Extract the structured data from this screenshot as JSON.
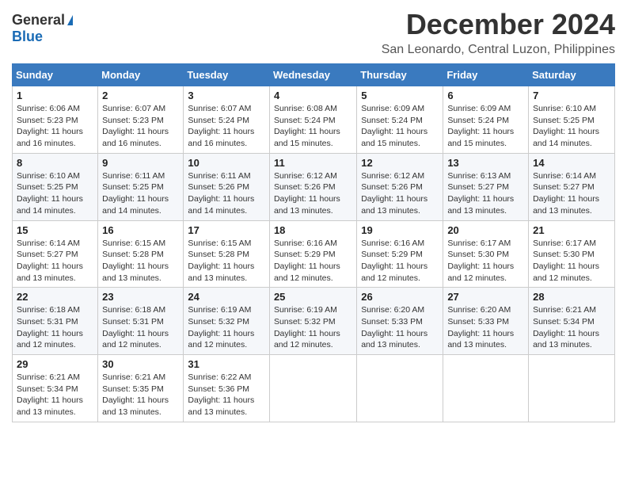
{
  "logo": {
    "line1": "General",
    "line2": "Blue"
  },
  "title": "December 2024",
  "subtitle": "San Leonardo, Central Luzon, Philippines",
  "days_header": [
    "Sunday",
    "Monday",
    "Tuesday",
    "Wednesday",
    "Thursday",
    "Friday",
    "Saturday"
  ],
  "weeks": [
    [
      {
        "day": "1",
        "info": "Sunrise: 6:06 AM\nSunset: 5:23 PM\nDaylight: 11 hours and 16 minutes."
      },
      {
        "day": "2",
        "info": "Sunrise: 6:07 AM\nSunset: 5:23 PM\nDaylight: 11 hours and 16 minutes."
      },
      {
        "day": "3",
        "info": "Sunrise: 6:07 AM\nSunset: 5:24 PM\nDaylight: 11 hours and 16 minutes."
      },
      {
        "day": "4",
        "info": "Sunrise: 6:08 AM\nSunset: 5:24 PM\nDaylight: 11 hours and 15 minutes."
      },
      {
        "day": "5",
        "info": "Sunrise: 6:09 AM\nSunset: 5:24 PM\nDaylight: 11 hours and 15 minutes."
      },
      {
        "day": "6",
        "info": "Sunrise: 6:09 AM\nSunset: 5:24 PM\nDaylight: 11 hours and 15 minutes."
      },
      {
        "day": "7",
        "info": "Sunrise: 6:10 AM\nSunset: 5:25 PM\nDaylight: 11 hours and 14 minutes."
      }
    ],
    [
      {
        "day": "8",
        "info": "Sunrise: 6:10 AM\nSunset: 5:25 PM\nDaylight: 11 hours and 14 minutes."
      },
      {
        "day": "9",
        "info": "Sunrise: 6:11 AM\nSunset: 5:25 PM\nDaylight: 11 hours and 14 minutes."
      },
      {
        "day": "10",
        "info": "Sunrise: 6:11 AM\nSunset: 5:26 PM\nDaylight: 11 hours and 14 minutes."
      },
      {
        "day": "11",
        "info": "Sunrise: 6:12 AM\nSunset: 5:26 PM\nDaylight: 11 hours and 13 minutes."
      },
      {
        "day": "12",
        "info": "Sunrise: 6:12 AM\nSunset: 5:26 PM\nDaylight: 11 hours and 13 minutes."
      },
      {
        "day": "13",
        "info": "Sunrise: 6:13 AM\nSunset: 5:27 PM\nDaylight: 11 hours and 13 minutes."
      },
      {
        "day": "14",
        "info": "Sunrise: 6:14 AM\nSunset: 5:27 PM\nDaylight: 11 hours and 13 minutes."
      }
    ],
    [
      {
        "day": "15",
        "info": "Sunrise: 6:14 AM\nSunset: 5:27 PM\nDaylight: 11 hours and 13 minutes."
      },
      {
        "day": "16",
        "info": "Sunrise: 6:15 AM\nSunset: 5:28 PM\nDaylight: 11 hours and 13 minutes."
      },
      {
        "day": "17",
        "info": "Sunrise: 6:15 AM\nSunset: 5:28 PM\nDaylight: 11 hours and 13 minutes."
      },
      {
        "day": "18",
        "info": "Sunrise: 6:16 AM\nSunset: 5:29 PM\nDaylight: 11 hours and 12 minutes."
      },
      {
        "day": "19",
        "info": "Sunrise: 6:16 AM\nSunset: 5:29 PM\nDaylight: 11 hours and 12 minutes."
      },
      {
        "day": "20",
        "info": "Sunrise: 6:17 AM\nSunset: 5:30 PM\nDaylight: 11 hours and 12 minutes."
      },
      {
        "day": "21",
        "info": "Sunrise: 6:17 AM\nSunset: 5:30 PM\nDaylight: 11 hours and 12 minutes."
      }
    ],
    [
      {
        "day": "22",
        "info": "Sunrise: 6:18 AM\nSunset: 5:31 PM\nDaylight: 11 hours and 12 minutes."
      },
      {
        "day": "23",
        "info": "Sunrise: 6:18 AM\nSunset: 5:31 PM\nDaylight: 11 hours and 12 minutes."
      },
      {
        "day": "24",
        "info": "Sunrise: 6:19 AM\nSunset: 5:32 PM\nDaylight: 11 hours and 12 minutes."
      },
      {
        "day": "25",
        "info": "Sunrise: 6:19 AM\nSunset: 5:32 PM\nDaylight: 11 hours and 12 minutes."
      },
      {
        "day": "26",
        "info": "Sunrise: 6:20 AM\nSunset: 5:33 PM\nDaylight: 11 hours and 13 minutes."
      },
      {
        "day": "27",
        "info": "Sunrise: 6:20 AM\nSunset: 5:33 PM\nDaylight: 11 hours and 13 minutes."
      },
      {
        "day": "28",
        "info": "Sunrise: 6:21 AM\nSunset: 5:34 PM\nDaylight: 11 hours and 13 minutes."
      }
    ],
    [
      {
        "day": "29",
        "info": "Sunrise: 6:21 AM\nSunset: 5:34 PM\nDaylight: 11 hours and 13 minutes."
      },
      {
        "day": "30",
        "info": "Sunrise: 6:21 AM\nSunset: 5:35 PM\nDaylight: 11 hours and 13 minutes."
      },
      {
        "day": "31",
        "info": "Sunrise: 6:22 AM\nSunset: 5:36 PM\nDaylight: 11 hours and 13 minutes."
      },
      null,
      null,
      null,
      null
    ]
  ]
}
